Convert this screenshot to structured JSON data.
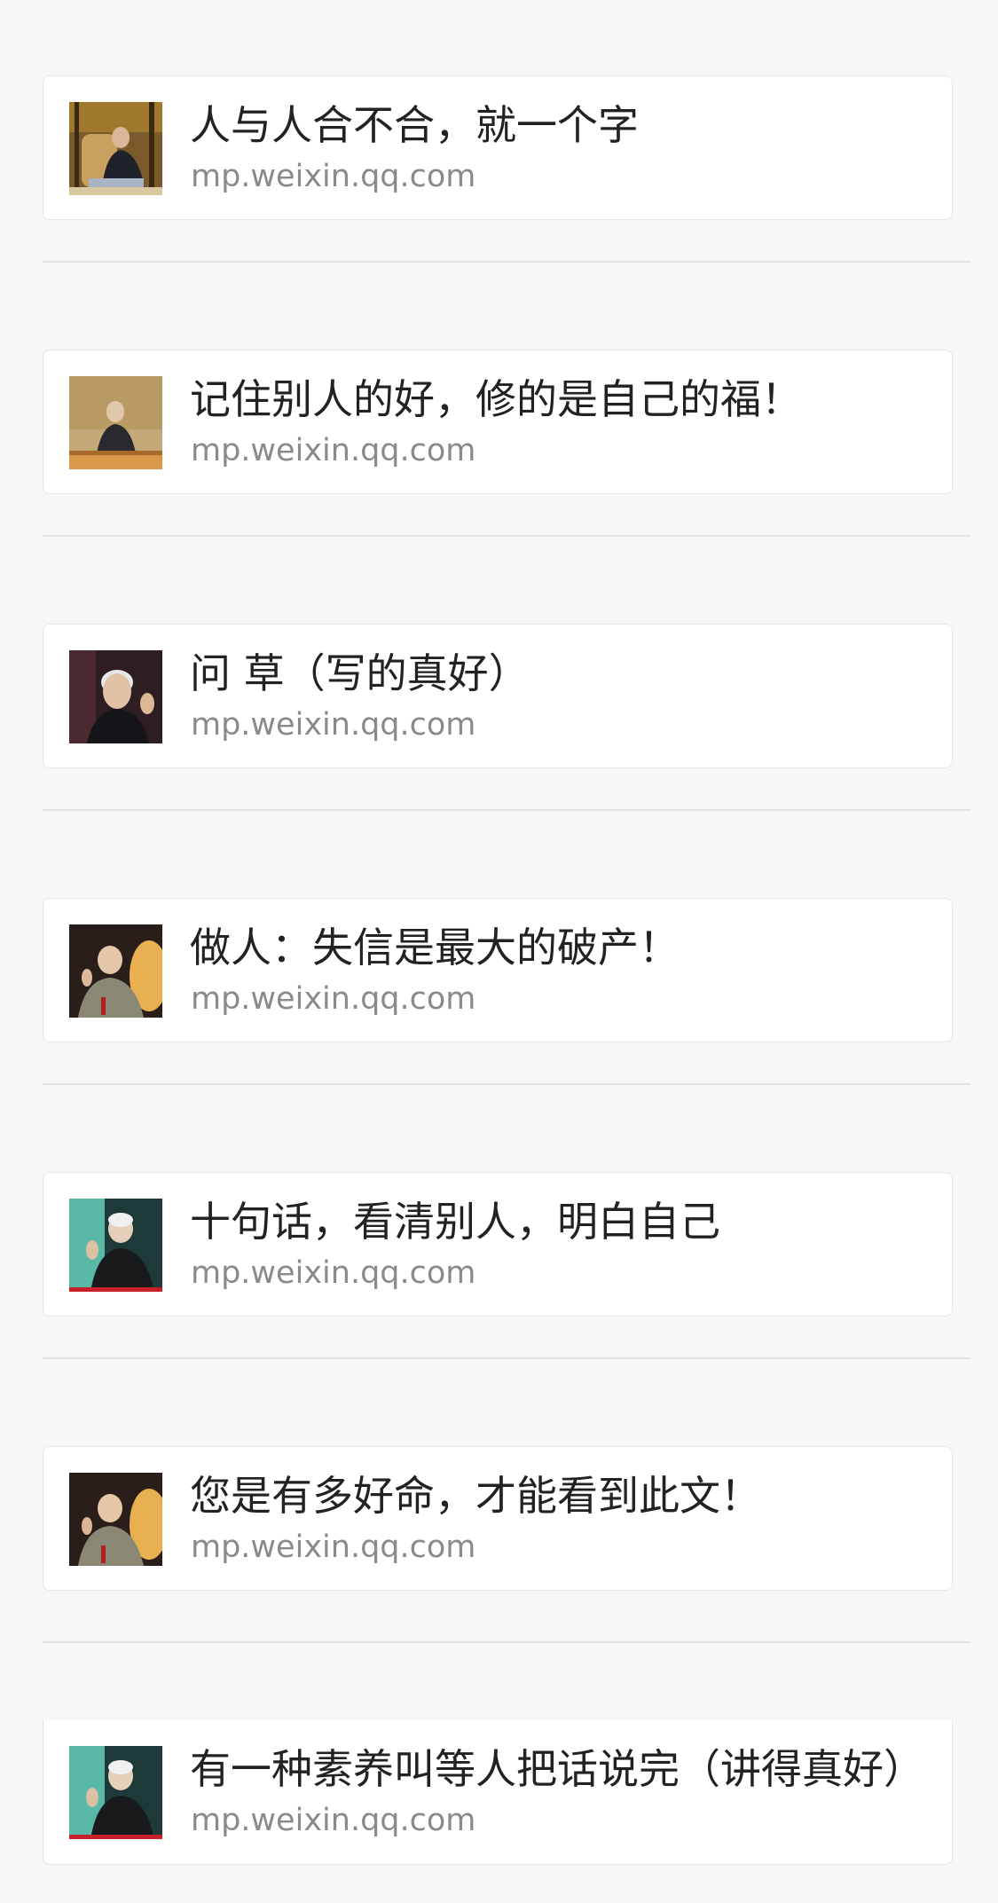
{
  "articles": [
    {
      "title": "人与人合不合，就一个字",
      "source": "mp.weixin.qq.com",
      "thumb": "elder-seated-in-armchair-photo"
    },
    {
      "title": "记住别人的好，修的是自己的福！",
      "source": "mp.weixin.qq.com",
      "thumb": "elder-seated-at-desk-photo"
    },
    {
      "title": "问 草（写的真好）",
      "source": "mp.weixin.qq.com",
      "thumb": "elder-portrait-gesturing-photo"
    },
    {
      "title": "做人：失信是最大的破产！",
      "source": "mp.weixin.qq.com",
      "thumb": "elder-speaking-at-podium-photo"
    },
    {
      "title": "十句话，看清别人，明白自己",
      "source": "mp.weixin.qq.com",
      "thumb": "elder-speaking-with-microphone-photo"
    },
    {
      "title": "您是有多好命，才能看到此文！",
      "source": "mp.weixin.qq.com",
      "thumb": "elder-speaking-at-podium-photo"
    },
    {
      "title": "有一种素养叫等人把话说完（讲得真好）",
      "source": "mp.weixin.qq.com",
      "thumb": "elder-speaking-with-microphone-photo"
    }
  ],
  "colors": {
    "page_background": "#f7f7f7",
    "card_background": "#ffffff",
    "title_text": "#222222",
    "source_text": "#8a8a8a",
    "divider": "#e3e3e3"
  }
}
